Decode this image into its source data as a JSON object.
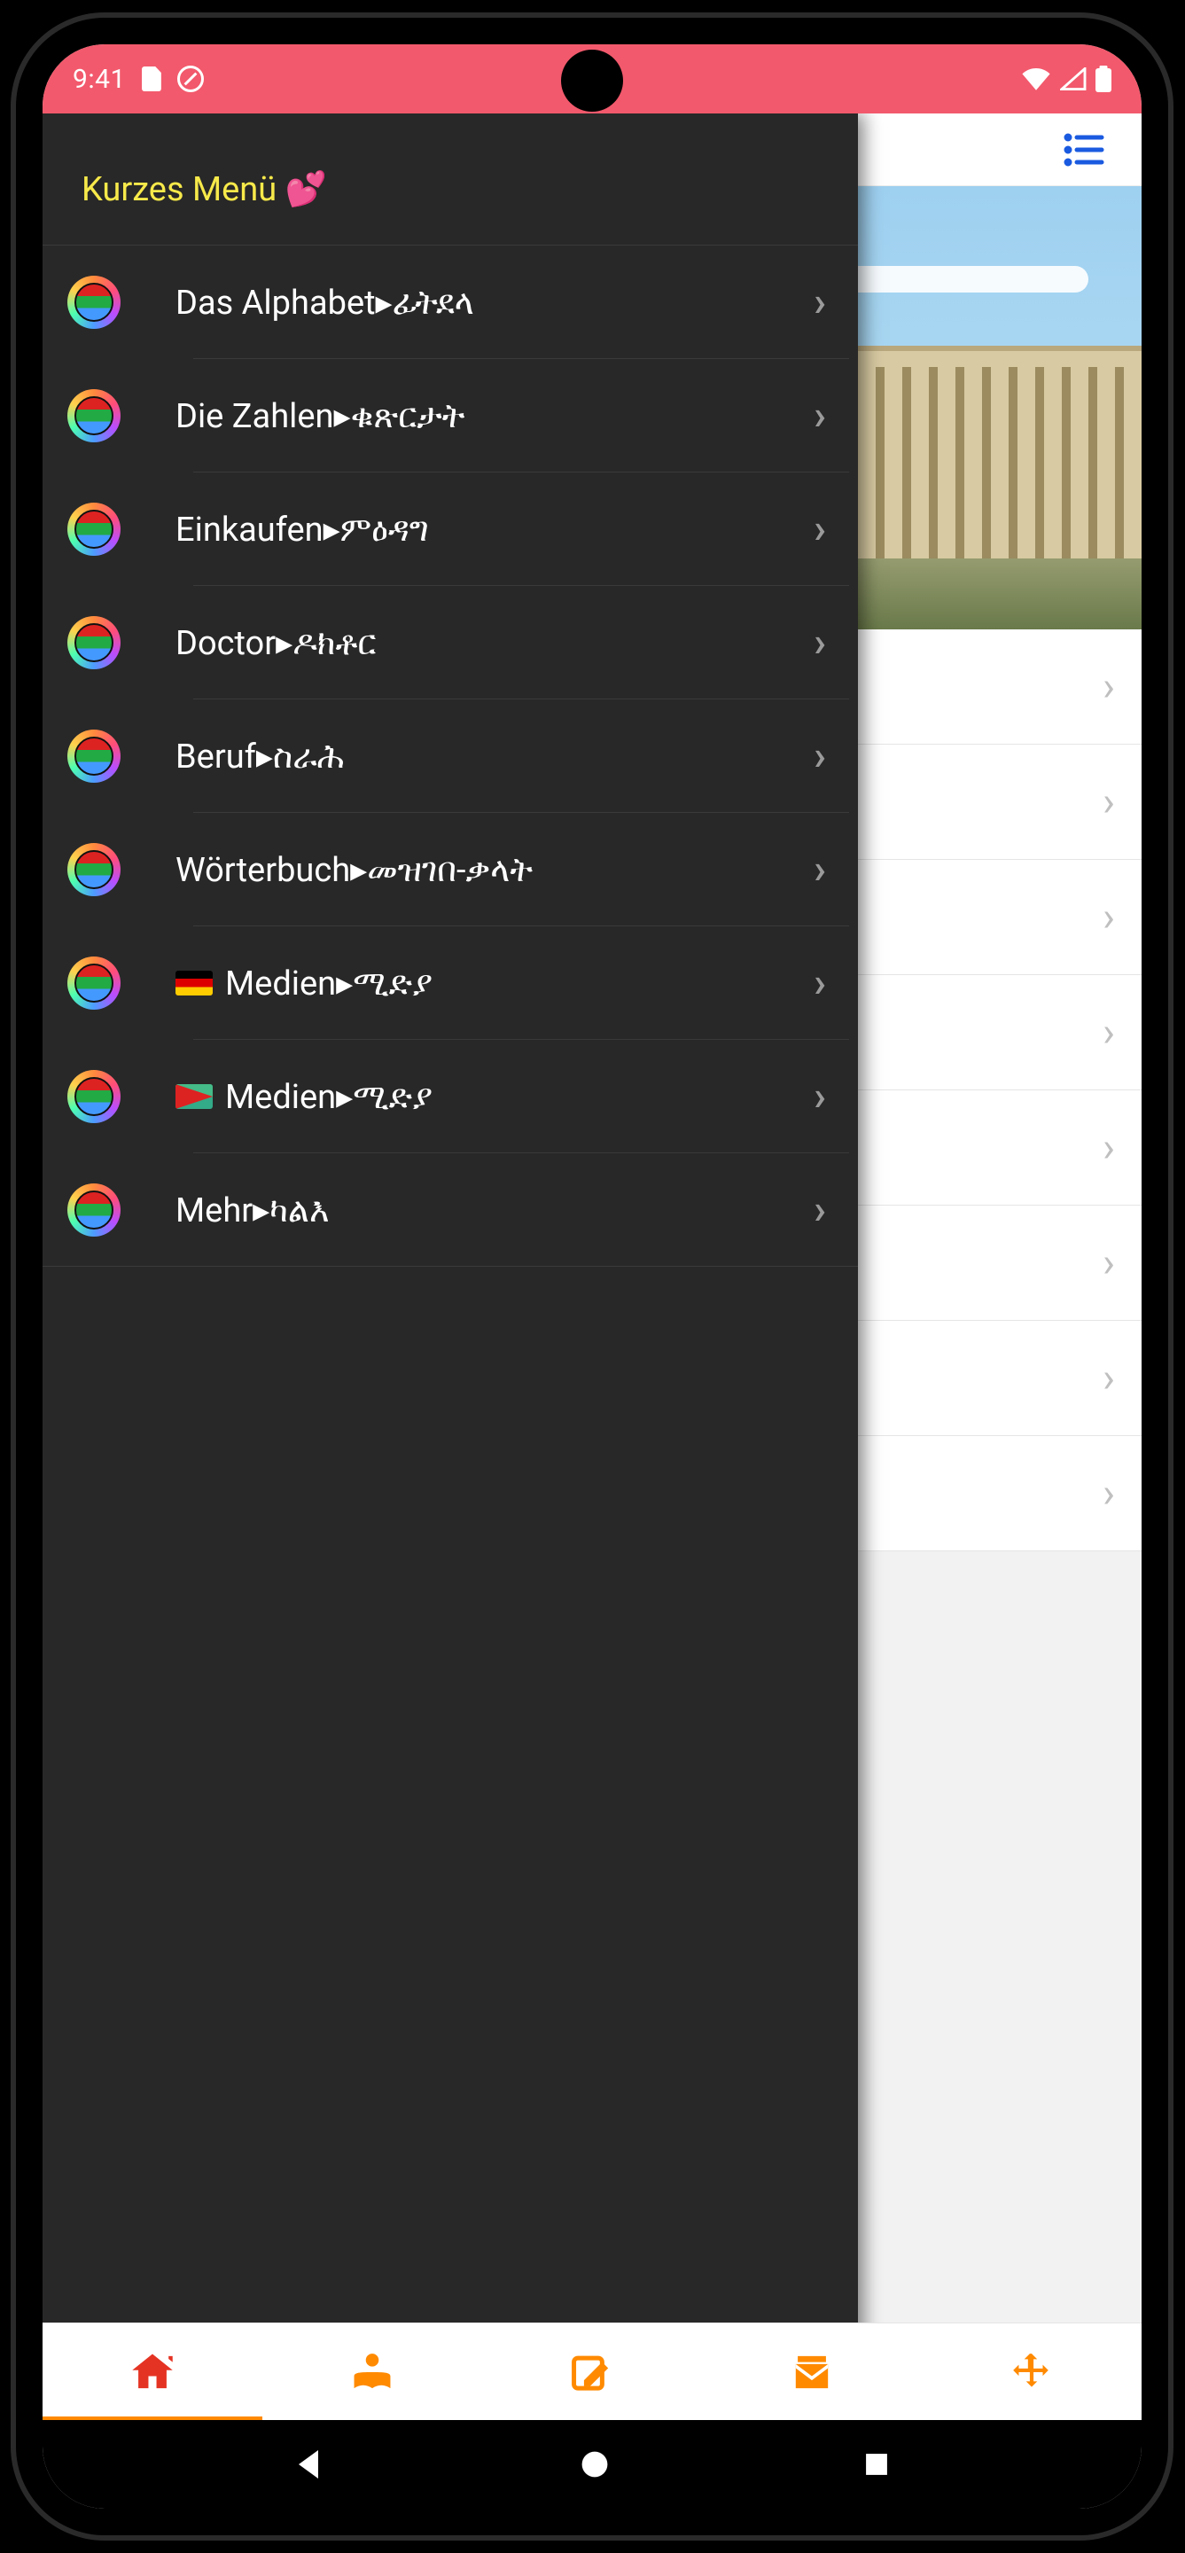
{
  "status": {
    "time": "9:41"
  },
  "header": {
    "title_visible": "en"
  },
  "drawer": {
    "title": "Kurzes Menü 💕",
    "items": [
      {
        "label": "Das Alphabet▸ፊትደላ"
      },
      {
        "label": "Die Zahlen▸ቁጽርታት"
      },
      {
        "label": "Einkaufen▸ምዕዳግ"
      },
      {
        "label": "Doctor▸ዶክቶር"
      },
      {
        "label": "Beruf▸ስራሕ"
      },
      {
        "label": "Wörterbuch▸መዝገበ-ቃላት"
      },
      {
        "label": "Medien▸ሚድያ",
        "flag": "de"
      },
      {
        "label": "Medien▸ሚድያ",
        "flag": "er"
      },
      {
        "label": "Mehr▸ካልእ"
      }
    ]
  },
  "content_rows": 8
}
